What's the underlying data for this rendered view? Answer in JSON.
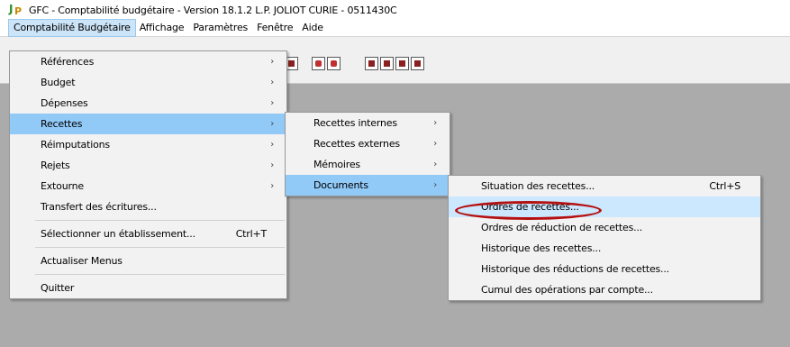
{
  "window": {
    "title": "GFC - Comptabilité budgétaire - Version 18.1.2   L.P. JOLIOT CURIE - 0511430C"
  },
  "menubar": [
    "Comptabilité Budgétaire",
    "Affichage",
    "Paramètres",
    "Fenêtre",
    "Aide"
  ],
  "main_menu": {
    "items": [
      {
        "label": "Références",
        "arrow": "›"
      },
      {
        "label": "Budget",
        "arrow": "›"
      },
      {
        "label": "Dépenses",
        "arrow": "›"
      },
      {
        "label": "Recettes",
        "arrow": "›"
      },
      {
        "label": "Réimputations",
        "arrow": "›"
      },
      {
        "label": "Rejets",
        "arrow": "›"
      },
      {
        "label": "Extourne",
        "arrow": "›"
      },
      {
        "label": "Transfert des écritures..."
      },
      {
        "label": "Sélectionner un établissement...",
        "shortcut": "Ctrl+T"
      },
      {
        "label": "Actualiser Menus"
      },
      {
        "label": "Quitter"
      }
    ]
  },
  "recettes_menu": {
    "items": [
      {
        "label": "Recettes internes",
        "arrow": "›"
      },
      {
        "label": "Recettes externes",
        "arrow": "›"
      },
      {
        "label": "Mémoires",
        "arrow": "›"
      },
      {
        "label": "Documents",
        "arrow": "›"
      }
    ]
  },
  "documents_menu": {
    "items": [
      {
        "label": "Situation des recettes...",
        "shortcut": "Ctrl+S"
      },
      {
        "label": "Ordres de recettes..."
      },
      {
        "label": "Ordres de réduction de recettes..."
      },
      {
        "label": "Historique des recettes..."
      },
      {
        "label": "Historique des réductions de recettes..."
      },
      {
        "label": "Cumul des opérations par compte..."
      }
    ]
  },
  "colors": {
    "highlight": "#91c9f7",
    "hover": "#cce8ff",
    "annotation_circle": "#b51010",
    "workspace": "#ababab"
  }
}
